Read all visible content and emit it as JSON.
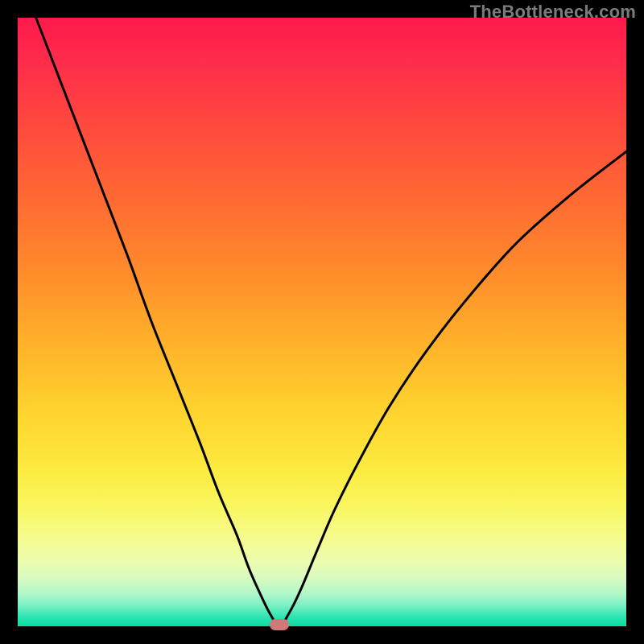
{
  "watermark": "TheBottleneck.com",
  "marker": {
    "x_frac": 0.43,
    "y_frac": 0.998
  },
  "chart_data": {
    "type": "line",
    "title": "",
    "xlabel": "",
    "ylabel": "",
    "xlim": [
      0,
      1
    ],
    "ylim": [
      0,
      1
    ],
    "series": [
      {
        "name": "bottleneck-curve",
        "x": [
          0.03,
          0.08,
          0.13,
          0.18,
          0.22,
          0.26,
          0.3,
          0.33,
          0.36,
          0.38,
          0.4,
          0.415,
          0.43,
          0.445,
          0.465,
          0.49,
          0.52,
          0.56,
          0.61,
          0.67,
          0.74,
          0.82,
          0.91,
          1.0
        ],
        "y": [
          1.0,
          0.87,
          0.74,
          0.61,
          0.5,
          0.4,
          0.3,
          0.22,
          0.15,
          0.095,
          0.05,
          0.02,
          0.0,
          0.02,
          0.06,
          0.12,
          0.19,
          0.27,
          0.36,
          0.45,
          0.54,
          0.63,
          0.71,
          0.78
        ]
      }
    ],
    "annotations": [
      {
        "type": "marker",
        "x": 0.43,
        "y": 0.0,
        "color": "#cf7a7a"
      }
    ]
  }
}
